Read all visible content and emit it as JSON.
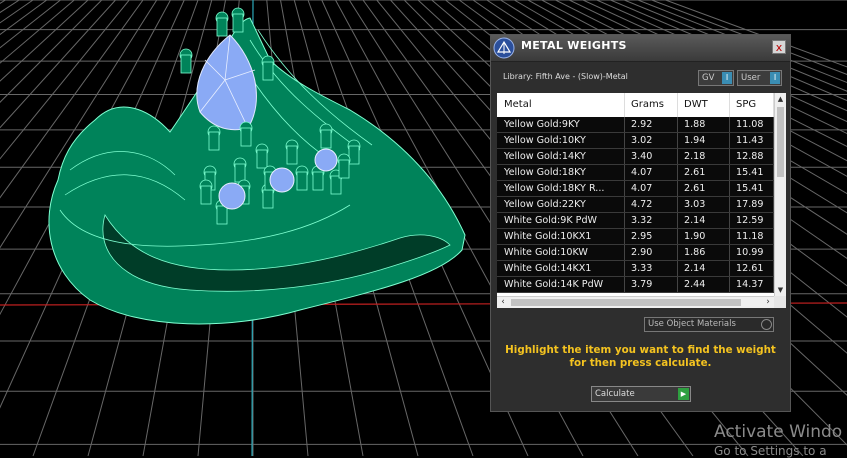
{
  "panel": {
    "title": "METAL WEIGHTS",
    "close_label": "x",
    "library_label": "Library: Fifth Ave - (Slow)-Metal",
    "gv_label": "GV",
    "user_label": "User",
    "toggle_glyph": "I",
    "columns": [
      "Metal",
      "Grams",
      "DWT",
      "SPG"
    ],
    "rows": [
      {
        "metal": "Yellow Gold:9KY",
        "grams": "2.92",
        "dwt": "1.88",
        "spg": "11.08"
      },
      {
        "metal": "Yellow Gold:10KY",
        "grams": "3.02",
        "dwt": "1.94",
        "spg": "11.43"
      },
      {
        "metal": "Yellow Gold:14KY",
        "grams": "3.40",
        "dwt": "2.18",
        "spg": "12.88"
      },
      {
        "metal": "Yellow Gold:18KY",
        "grams": "4.07",
        "dwt": "2.61",
        "spg": "15.41"
      },
      {
        "metal": "Yellow Gold:18KY R...",
        "grams": "4.07",
        "dwt": "2.61",
        "spg": "15.41"
      },
      {
        "metal": "Yellow Gold:22KY",
        "grams": "4.72",
        "dwt": "3.03",
        "spg": "17.89"
      },
      {
        "metal": "White Gold:9K PdW",
        "grams": "3.32",
        "dwt": "2.14",
        "spg": "12.59"
      },
      {
        "metal": "White Gold:10KX1",
        "grams": "2.95",
        "dwt": "1.90",
        "spg": "11.18"
      },
      {
        "metal": "White Gold:10KW",
        "grams": "2.90",
        "dwt": "1.86",
        "spg": "10.99"
      },
      {
        "metal": "White Gold:14KX1",
        "grams": "3.33",
        "dwt": "2.14",
        "spg": "12.61"
      },
      {
        "metal": "White Gold:14K PdW",
        "grams": "3.79",
        "dwt": "2.44",
        "spg": "14.37"
      }
    ],
    "use_object_materials": "Use Object Materials",
    "instructions_line1": "Highlight the item you want to find the weight",
    "instructions_line2": "for then press calculate.",
    "calculate_label": "Calculate",
    "calc_glyph": "▶"
  },
  "watermark": {
    "line1": "Activate Windo",
    "line2": "Go to Settings to a"
  },
  "colors": {
    "ring_green": "#00835a",
    "gem_blue": "#8aaaf5",
    "grid": "#7a7a7a",
    "highlight_yellow": "#f4c320"
  }
}
